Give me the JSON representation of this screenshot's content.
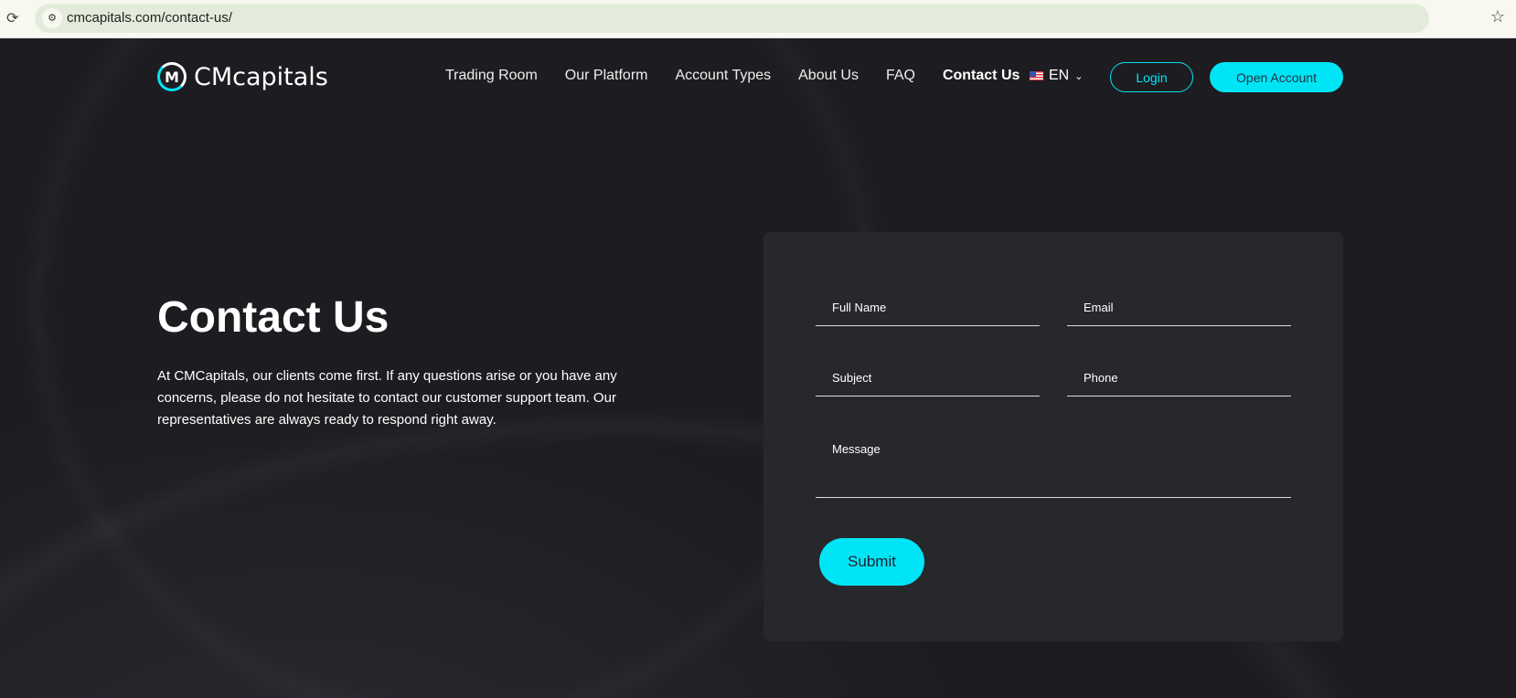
{
  "browser": {
    "url": "cmcapitals.com/contact-us/"
  },
  "header": {
    "logo": "CMcapitals",
    "nav": [
      "Trading Room",
      "Our Platform",
      "Account Types",
      "About Us",
      "FAQ",
      "Contact Us"
    ],
    "lang": "EN",
    "login": "Login",
    "open_account": "Open Account"
  },
  "hero": {
    "title": "Contact Us",
    "text": "At CMCapitals, our clients come first. If any questions arise or you have any concerns, please do not hesitate to contact our customer support team. Our representatives are always ready to respond right away."
  },
  "form": {
    "full_name": "Full Name",
    "email": "Email",
    "subject": "Subject",
    "phone": "Phone",
    "message": "Message",
    "submit": "Submit"
  },
  "colors": {
    "accent": "#00e5f5",
    "bg": "#1d1d21",
    "card": "#27282c"
  }
}
